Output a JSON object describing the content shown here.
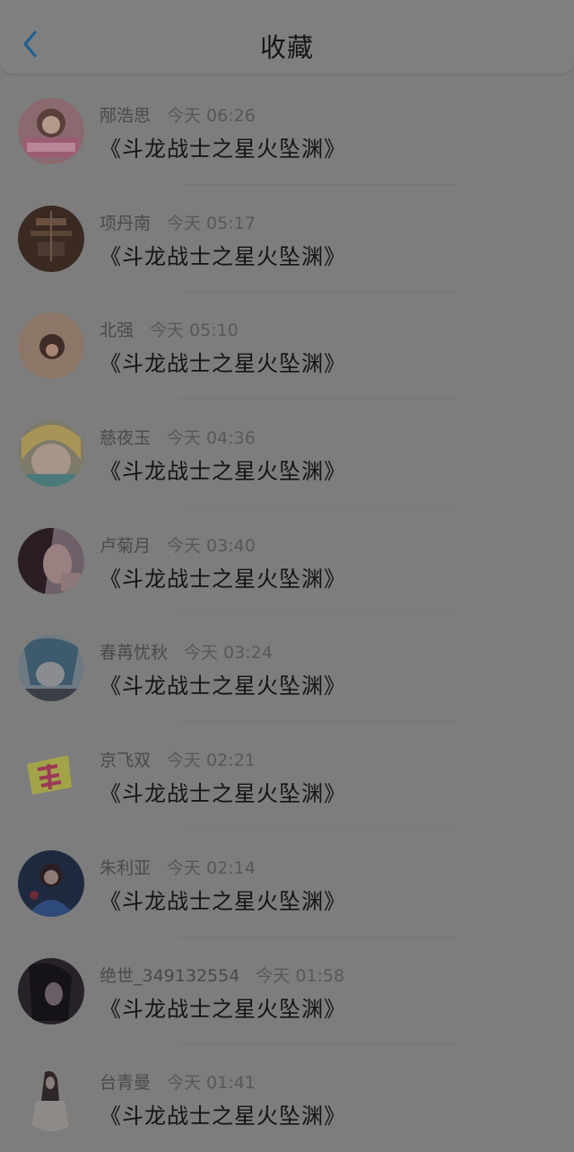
{
  "header": {
    "title": "收藏"
  },
  "items": [
    {
      "user": "邴浩思",
      "time": "今天 06:26",
      "content": "《斗龙战士之星火坠渊》",
      "avatar": "birthday-girl-avatar"
    },
    {
      "user": "项丹南",
      "time": "今天 05:17",
      "content": "《斗龙战士之星火坠渊》",
      "avatar": "chandelier-avatar"
    },
    {
      "user": "北强",
      "time": "今天 05:10",
      "content": "《斗龙战士之星火坠渊》",
      "avatar": "doll-avatar"
    },
    {
      "user": "慈夜玉",
      "time": "今天 04:36",
      "content": "《斗龙战士之星火坠渊》",
      "avatar": "anime-blonde-avatar"
    },
    {
      "user": "卢菊月",
      "time": "今天 03:40",
      "content": "《斗龙战士之星火坠渊》",
      "avatar": "girl-portrait-avatar"
    },
    {
      "user": "春苒忧秋",
      "time": "今天 03:24",
      "content": "《斗龙战士之星火坠渊》",
      "avatar": "anime-blue-avatar"
    },
    {
      "user": "京飞双",
      "time": "今天 02:21",
      "content": "《斗龙战士之星火坠渊》",
      "avatar": "yellow-sticker-avatar"
    },
    {
      "user": "朱利亚",
      "time": "今天 02:14",
      "content": "《斗龙战士之星火坠渊》",
      "avatar": "dark-blue-anime-avatar"
    },
    {
      "user": "绝世_349132554",
      "time": "今天 01:58",
      "content": "《斗龙战士之星火坠渊》",
      "avatar": "dark-hair-avatar"
    },
    {
      "user": "台青曼",
      "time": "今天 01:41",
      "content": "《斗龙战士之星火坠渊》",
      "avatar": "white-dress-avatar"
    }
  ],
  "colors": {
    "accent": "#1a5f96",
    "overlay": "#7d7d7d"
  }
}
